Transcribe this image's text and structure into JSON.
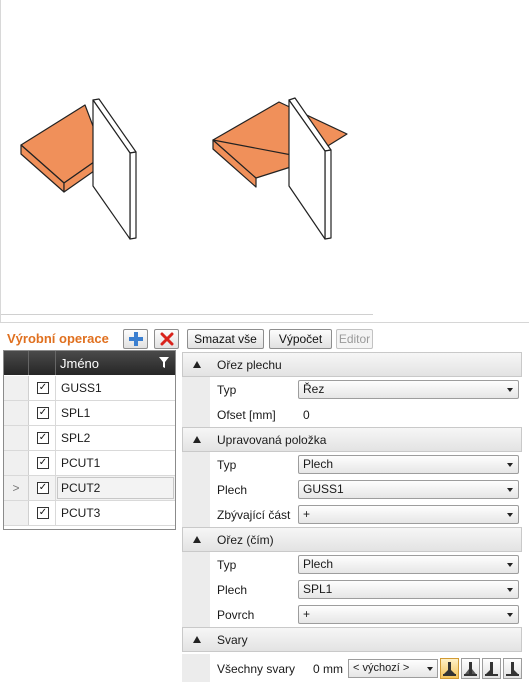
{
  "toolbar": {
    "title": "Výrobní operace",
    "add_icon": "plus-icon",
    "delete_icon": "red-x-icon",
    "clear_all_label": "Smazat vše",
    "compute_label": "Výpočet",
    "editor_label": "Editor"
  },
  "grid": {
    "column_name": "Jméno",
    "filter_icon": "filter-icon",
    "rows": [
      {
        "name": "GUSS1",
        "checked": true,
        "selected": false
      },
      {
        "name": "SPL1",
        "checked": true,
        "selected": false
      },
      {
        "name": "SPL2",
        "checked": true,
        "selected": false
      },
      {
        "name": "PCUT1",
        "checked": true,
        "selected": false
      },
      {
        "name": "PCUT2",
        "checked": true,
        "selected": true
      },
      {
        "name": "PCUT3",
        "checked": true,
        "selected": false
      }
    ],
    "selected_marker": ">"
  },
  "properties": {
    "section1": {
      "title": "Ořez plechu",
      "type_label": "Typ",
      "type_value": "Řez",
      "offset_label": "Ofset [mm]",
      "offset_value": "0"
    },
    "section2": {
      "title": "Upravovaná položka",
      "type_label": "Typ",
      "type_value": "Plech",
      "plate_label": "Plech",
      "plate_value": "GUSS1",
      "remaining_label": "Zbývající část",
      "remaining_value": "+"
    },
    "section3": {
      "title": "Ořez (čím)",
      "type_label": "Typ",
      "type_value": "Plech",
      "plate_label": "Plech",
      "plate_value": "SPL1",
      "surface_label": "Povrch",
      "surface_value": "+"
    },
    "section4": {
      "title": "Svary",
      "all_welds_label": "Všechny svary",
      "weld_size": "0 mm",
      "weld_default": "< výchozí >"
    }
  },
  "colors": {
    "accent": "#e0701f",
    "plate_fill": "#f0905a"
  }
}
